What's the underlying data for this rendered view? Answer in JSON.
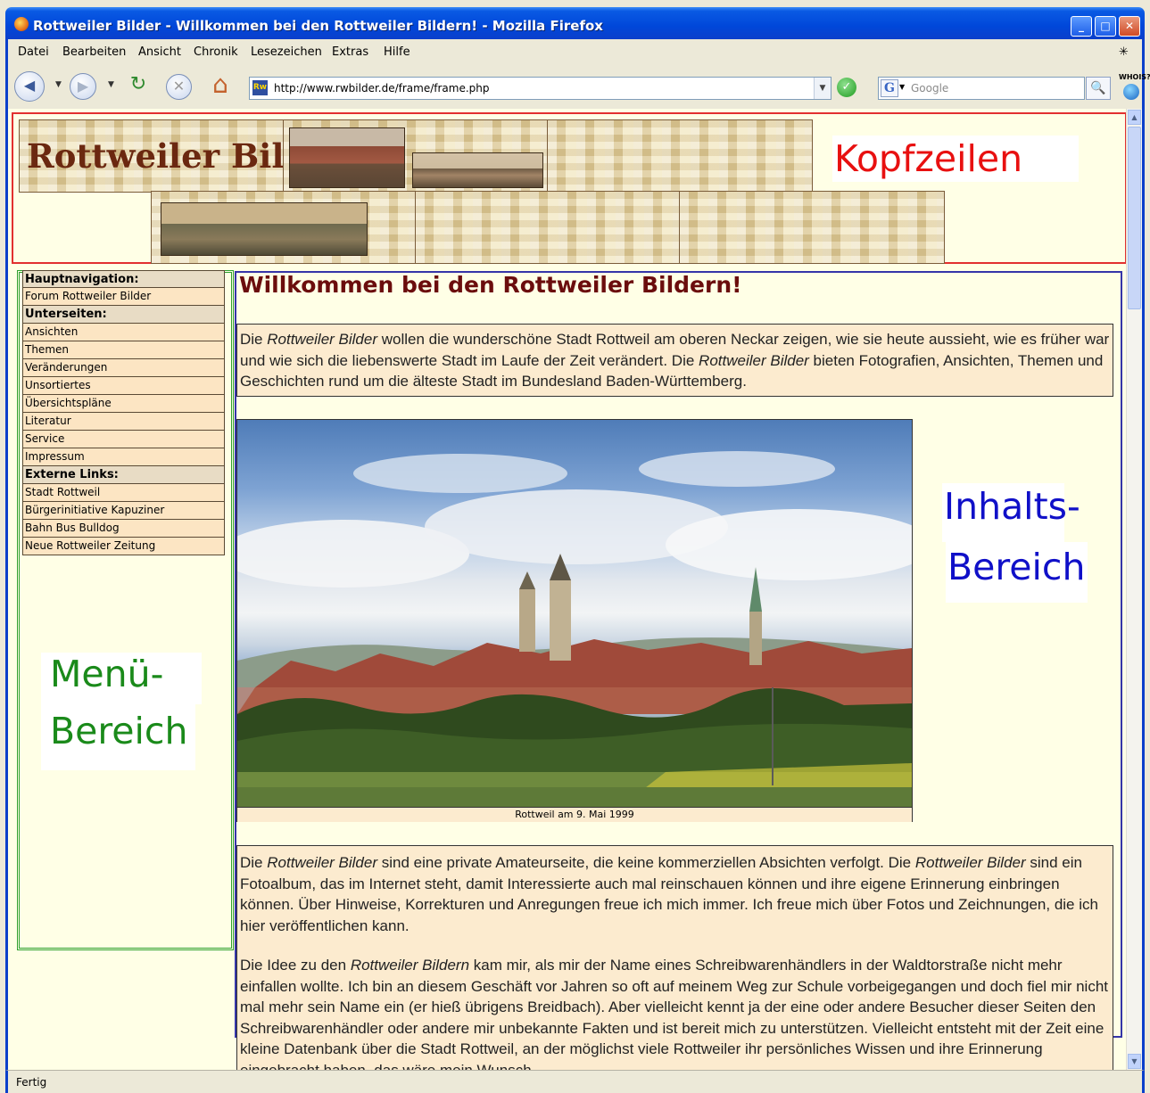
{
  "window": {
    "title": "Rottweiler Bilder - Willkommen bei den Rottweiler Bildern! - Mozilla Firefox",
    "min": "_",
    "max": "□",
    "close": "✕"
  },
  "menubar": [
    "Datei",
    "Bearbeiten",
    "Ansicht",
    "Chronik",
    "Lesezeichen",
    "Extras",
    "Hilfe"
  ],
  "navbar": {
    "url": "http://www.rwbilder.de/frame/frame.php",
    "favicon": "Rw",
    "search_placeholder": "Google",
    "search_engine_letter": "G",
    "whois": "WHOIS?"
  },
  "header": {
    "logo": "Rottweiler Bilder",
    "annotation": "Kopfzeilen"
  },
  "menu": {
    "items": [
      {
        "label": "Hauptnavigation:",
        "section": true
      },
      {
        "label": "Forum Rottweiler Bilder",
        "section": false
      },
      {
        "label": "Unterseiten:",
        "section": true
      },
      {
        "label": "Ansichten",
        "section": false
      },
      {
        "label": "Themen",
        "section": false
      },
      {
        "label": "Veränderungen",
        "section": false
      },
      {
        "label": "Unsortiertes",
        "section": false
      },
      {
        "label": "Übersichtspläne",
        "section": false
      },
      {
        "label": "Literatur",
        "section": false
      },
      {
        "label": "Service",
        "section": false
      },
      {
        "label": "Impressum",
        "section": false
      },
      {
        "label": "Externe Links:",
        "section": true
      },
      {
        "label": "Stadt Rottweil",
        "section": false
      },
      {
        "label": "Bürgerinitiative Kapuziner",
        "section": false
      },
      {
        "label": "Bahn Bus Bulldog",
        "section": false
      },
      {
        "label": "Neue Rottweiler Zeitung",
        "section": false
      }
    ],
    "annotation_line1": "Menü-",
    "annotation_line2": "Bereich"
  },
  "content": {
    "title": "Willkommen bei den Rottweiler Bildern!",
    "intro": [
      {
        "t": "Die ",
        "i": false
      },
      {
        "t": "Rottweiler Bilder",
        "i": true
      },
      {
        "t": " wollen die wunderschöne Stadt Rottweil am oberen Neckar zeigen, wie sie heute aussieht, wie es früher war und wie sich die liebenswerte Stadt im Laufe der Zeit verändert. Die ",
        "i": false
      },
      {
        "t": "Rottweiler Bilder",
        "i": true
      },
      {
        "t": " bieten Fotografien, Ansichten, Themen und Geschichten rund um die älteste Stadt im Bundesland Baden-Württemberg.",
        "i": false
      }
    ],
    "photo_caption": "Rottweil am 9. Mai 1999",
    "para1": [
      {
        "t": "Die ",
        "i": false
      },
      {
        "t": "Rottweiler Bilder",
        "i": true
      },
      {
        "t": " sind eine private Amateurseite, die keine kommerziellen Absichten verfolgt. Die ",
        "i": false
      },
      {
        "t": "Rottweiler Bilder",
        "i": true
      },
      {
        "t": " sind ein Fotoalbum, das im Internet steht, damit Interessierte auch mal reinschauen können und ihre eigene Erinnerung einbringen können. Über Hinweise, Korrekturen und Anregungen freue ich mich immer. Ich freue mich über Fotos und Zeichnungen, die ich hier veröffentlichen kann.",
        "i": false
      }
    ],
    "para2": [
      {
        "t": "Die Idee zu den ",
        "i": false
      },
      {
        "t": "Rottweiler Bildern",
        "i": true
      },
      {
        "t": " kam mir, als mir der Name eines Schreibwarenhändlers in der Waldtorstraße nicht mehr einfallen wollte. Ich bin an diesem Geschäft vor Jahren so oft auf meinem Weg zur Schule vorbeigegangen und doch fiel mir nicht mal mehr sein Name ein (er hieß übrigens Breidbach). Aber vielleicht kennt ja der eine oder andere Besucher dieser Seiten den Schreibwarenhändler oder andere mir unbekannte Fakten und ist bereit mich zu unterstützen. Vielleicht entsteht mit der Zeit eine kleine Datenbank über die Stadt Rottweil, an der möglichst viele Rottweiler ihr persönliches Wissen und ihre Erinnerung eingebracht haben, das wäre mein Wunsch.",
        "i": false
      }
    ],
    "annotation_line1": "Inhalts-",
    "annotation_line2": "Bereich"
  },
  "status": "Fertig",
  "colors": {
    "page_bg": "#FFFFE6",
    "header_frame": "#E23030",
    "menu_frame": "#2DA02D",
    "content_frame": "#3535A8",
    "title_color": "#6B0D0D",
    "annotation_red": "#E81010",
    "annotation_green": "#1A8A1A",
    "annotation_blue": "#1010C8"
  }
}
